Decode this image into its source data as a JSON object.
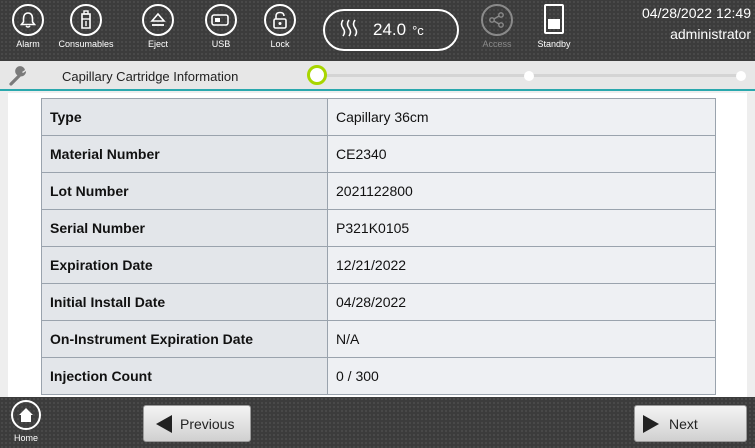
{
  "topbar": {
    "buttons": [
      {
        "label": "Alarm",
        "icon": "bell-icon"
      },
      {
        "label": "Consumables",
        "icon": "reagent-bottle-icon"
      },
      {
        "label": "Eject",
        "icon": "eject-icon"
      },
      {
        "label": "USB",
        "icon": "usb-icon"
      },
      {
        "label": "Lock",
        "icon": "lock-icon"
      }
    ],
    "temperature": {
      "value": "24.0",
      "unit": "°c",
      "icon": "heat-waves-icon"
    },
    "access": {
      "label": "Access",
      "icon": "share-icon",
      "enabled": false
    },
    "standby": {
      "label": "Standby",
      "icon": "standby-icon"
    },
    "datetime": "04/28/2022 12:49",
    "user": "administrator"
  },
  "stepbar": {
    "title": "Capillary Cartridge Information",
    "icon": "wrench-icon",
    "steps_total": 4,
    "current_step": 1,
    "active_color": "#a8d600",
    "accent_color": "#2aa8ad"
  },
  "info": {
    "rows": [
      {
        "label": "Type",
        "value": "Capillary 36cm"
      },
      {
        "label": "Material Number",
        "value": "CE2340"
      },
      {
        "label": "Lot Number",
        "value": "2021122800"
      },
      {
        "label": "Serial Number",
        "value": "P321K0105"
      },
      {
        "label": "Expiration Date",
        "value": "12/21/2022"
      },
      {
        "label": "Initial Install Date",
        "value": "04/28/2022"
      },
      {
        "label": "On-Instrument Expiration Date",
        "value": "N/A"
      },
      {
        "label": "Injection Count",
        "value": "0 / 300"
      }
    ]
  },
  "bottombar": {
    "home_label": "Home",
    "previous_label": "Previous",
    "next_label": "Next"
  }
}
